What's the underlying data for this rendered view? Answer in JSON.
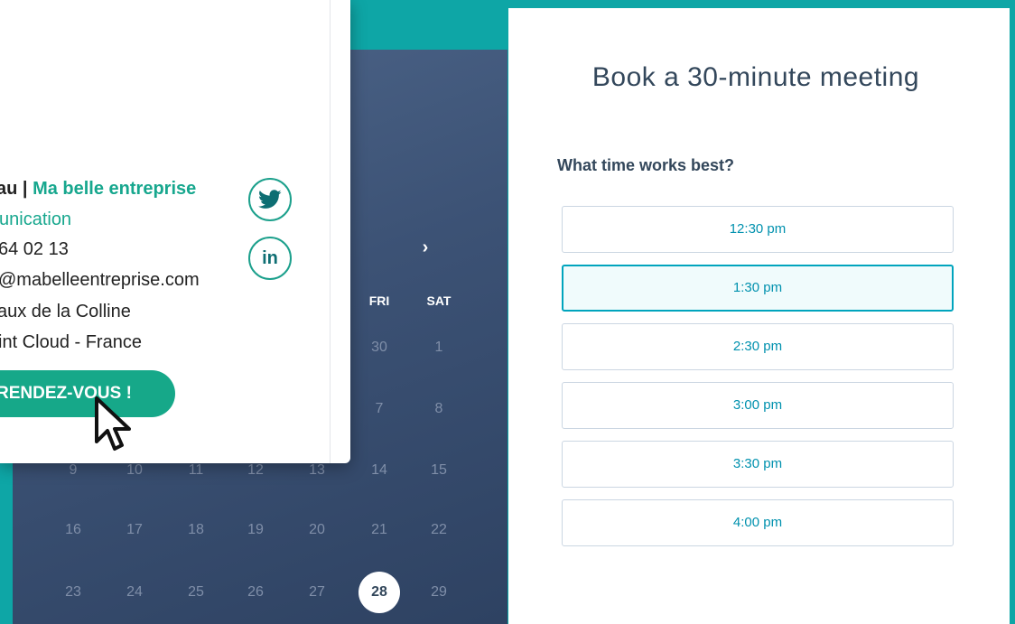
{
  "calendar": {
    "next_icon": "chevron-right-icon",
    "weekday_labels": [
      "FRI",
      "SAT"
    ],
    "weeks": [
      [
        "",
        "",
        "",
        "",
        "",
        "30",
        "1"
      ],
      [
        "",
        "",
        "",
        "",
        "",
        "7",
        "8"
      ],
      [
        "9",
        "10",
        "11",
        "12",
        "13",
        "14",
        "15"
      ],
      [
        "16",
        "17",
        "18",
        "19",
        "20",
        "21",
        "22"
      ],
      [
        "23",
        "24",
        "25",
        "26",
        "27",
        "28",
        "29"
      ]
    ],
    "selected_day": "28"
  },
  "signature": {
    "line1_name_part": "au | ",
    "line1_company": "Ma belle entreprise",
    "line2": "unication",
    "line3": "64 02 13",
    "line4": "@mabelleentreprise.com",
    "line5": "aux de la Colline",
    "line6": "int Cloud - France",
    "cta_label": "RENDEZ-VOUS !",
    "social": [
      "twitter-icon",
      "linkedin-icon"
    ],
    "linkedin_text": "in"
  },
  "booking": {
    "title": "Book a 30-minute meeting",
    "question": "What time works best?",
    "slots": [
      "12:30 pm",
      "1:30 pm",
      "2:30 pm",
      "3:00 pm",
      "3:30 pm",
      "4:00 pm"
    ],
    "selected_slot": "1:30 pm"
  },
  "colors": {
    "background": "#0ea6a6",
    "accent_teal": "#16a889",
    "slot_text": "#0091ae",
    "heading": "#33475b"
  }
}
